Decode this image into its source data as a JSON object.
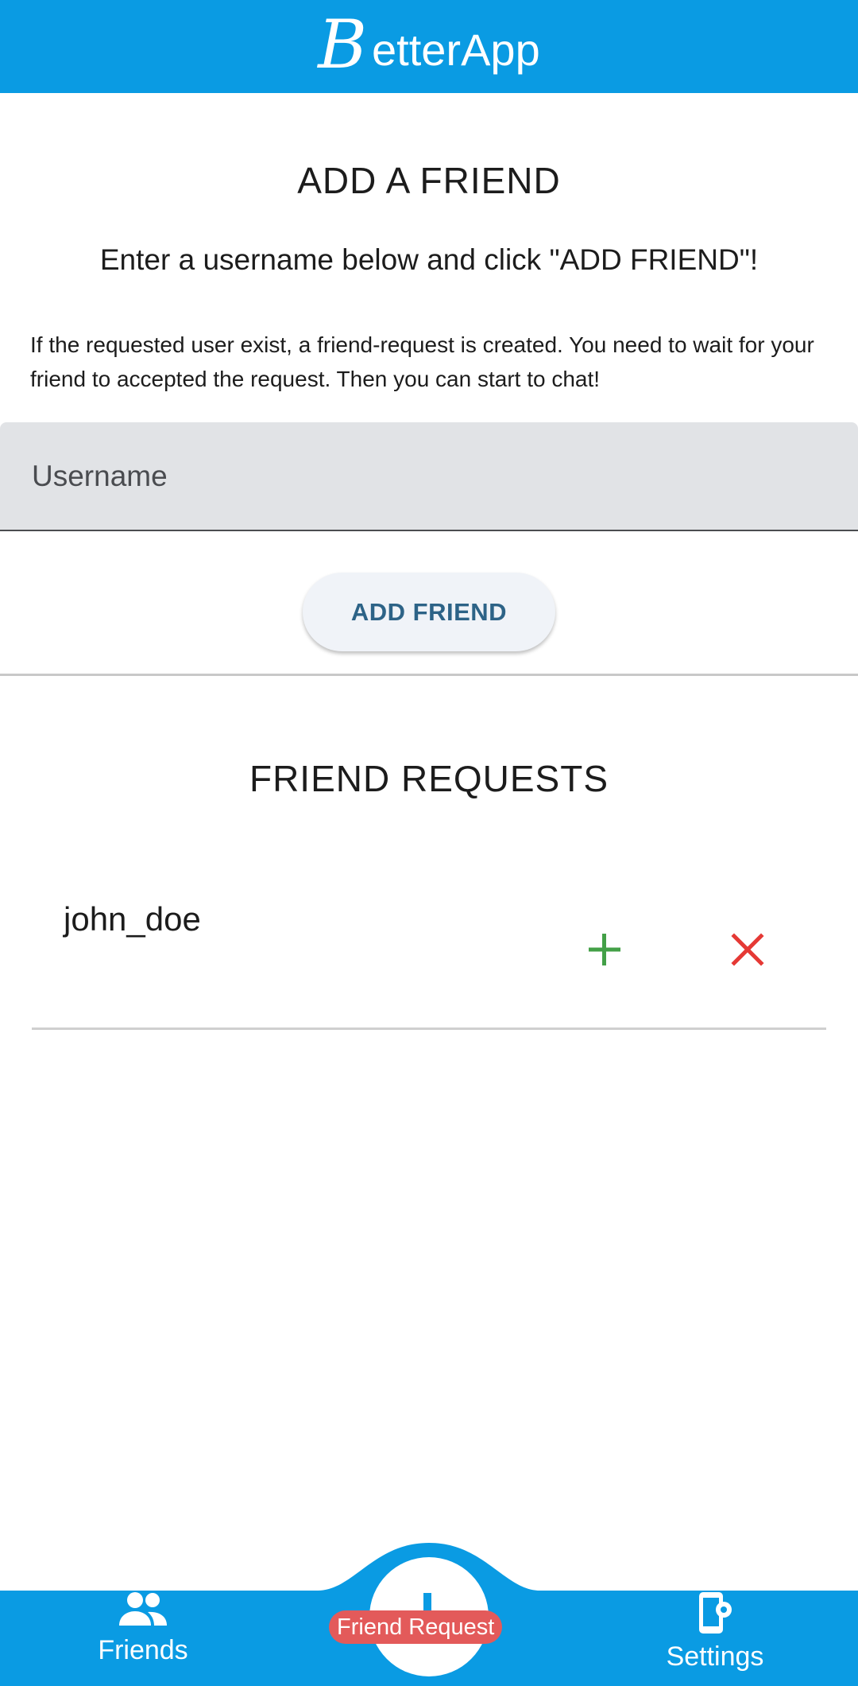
{
  "app": {
    "logo_letter": "B",
    "title_rest": "etterApp",
    "brand_color": "#0a9be3"
  },
  "add_friend": {
    "title": "ADD A FRIEND",
    "subtitle": "Enter a username below and click \"ADD FRIEND\"!",
    "description": "If the requested user exist, a friend-request is created. You need to wait for your friend to accepted the request. Then you can start to chat!",
    "username_placeholder": "Username",
    "username_value": "",
    "button_label": "ADD FRIEND"
  },
  "friend_requests": {
    "title": "FRIEND REQUESTS",
    "items": [
      {
        "username": "john_doe",
        "accept_icon": "plus-icon",
        "decline_icon": "close-icon",
        "accept_color": "#43a047",
        "decline_color": "#e53935"
      }
    ]
  },
  "bottom_nav": {
    "friends_label": "Friends",
    "friends_icon": "people-icon",
    "center_badge": "Friend Request",
    "center_icon": "plus-icon",
    "settings_label": "Settings",
    "settings_icon": "phone-settings-icon",
    "badge_color": "#e35a5a"
  }
}
